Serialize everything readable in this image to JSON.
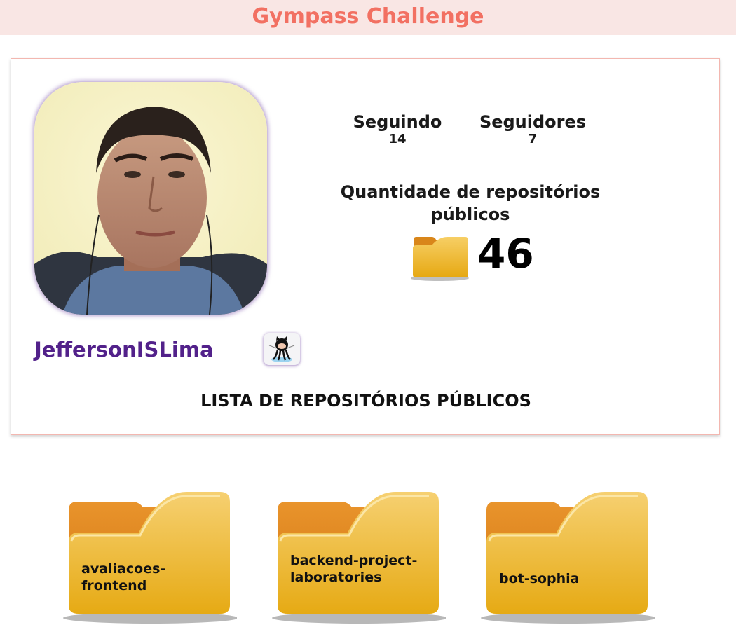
{
  "header": {
    "title": "Gympass Challenge"
  },
  "profile": {
    "username": "JeffersonISLima",
    "following_label": "Seguindo",
    "following_count": "14",
    "followers_label": "Seguidores",
    "followers_count": "7",
    "repo_count_label": "Quantidade de repositórios públicos",
    "repo_count": "46",
    "github_icon": "github-octocat-icon"
  },
  "repos": {
    "title": "LISTA DE REPOSITÓRIOS PÚBLICOS",
    "items": [
      {
        "name": "avaliacoes-frontend"
      },
      {
        "name": "backend-project-laboratories"
      },
      {
        "name": "bot-sophia"
      }
    ]
  },
  "colors": {
    "header_bg": "#f9e6e4",
    "header_text": "#f27062",
    "username": "#52218a",
    "folder": "#e8b32a"
  }
}
